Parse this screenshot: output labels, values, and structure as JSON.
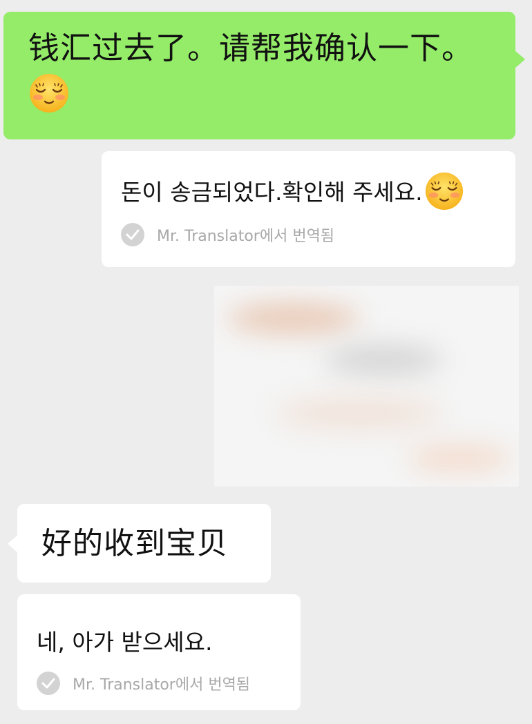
{
  "messages": {
    "outgoing": {
      "text": "钱汇过去了。请帮我确认一下。",
      "emoji": "smiling-blushing-face-icon",
      "bubble_color": "#95ec69"
    },
    "outgoing_translation": {
      "text": "돈이 송금되었다.확인해 주세요.",
      "emoji": "smiling-blushing-face-icon",
      "translated_label": "Mr. Translator에서 번역됨"
    },
    "image": {
      "description_icon": "blurred-image"
    },
    "incoming": {
      "text": "好的收到宝贝",
      "bubble_color": "#ffffff"
    },
    "incoming_translation": {
      "text": "네, 아가 받으세요.",
      "translated_label": "Mr. Translator에서 번역됨"
    }
  },
  "colors": {
    "background": "#ededed",
    "check_icon": "#d3d3d3",
    "label_gray": "#a8a8a8"
  }
}
